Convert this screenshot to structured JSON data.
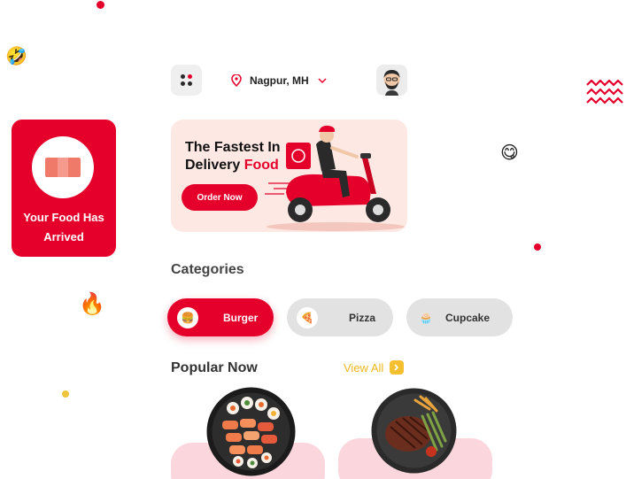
{
  "header": {
    "location": "Nagpur, MH",
    "menu_icon": "dots-grid-icon",
    "location_icon": "location-pin-icon",
    "dropdown_icon": "chevron-down-icon",
    "avatar_icon": "user-avatar-icon"
  },
  "notification": {
    "text": "Your Food Has Arrived",
    "icon": "package-box-icon"
  },
  "banner": {
    "title_line1": "The Fastest In",
    "title_line2": "Delivery",
    "title_accent": "Food",
    "cta_label": "Order Now",
    "illustration": "delivery-scooter-rider"
  },
  "categories": {
    "title": "Categories",
    "items": [
      {
        "label": "Burger",
        "icon": "burger-icon",
        "active": true
      },
      {
        "label": "Pizza",
        "icon": "pizza-icon",
        "active": false
      },
      {
        "label": "Cupcake",
        "icon": "cupcake-icon",
        "active": false
      }
    ]
  },
  "popular": {
    "title": "Popular Now",
    "view_all_label": "View All",
    "items": [
      {
        "image": "sushi-platter"
      },
      {
        "image": "steak-plate"
      }
    ]
  },
  "decorations": {
    "emojis": [
      "🤣",
      "😋",
      "🔥"
    ]
  },
  "colors": {
    "primary": "#e4002b",
    "accent_yellow": "#f0b71e",
    "banner_bg": "#fde8e4",
    "card_bg": "#fbd6dc",
    "pill_idle": "#e2e2e2"
  }
}
